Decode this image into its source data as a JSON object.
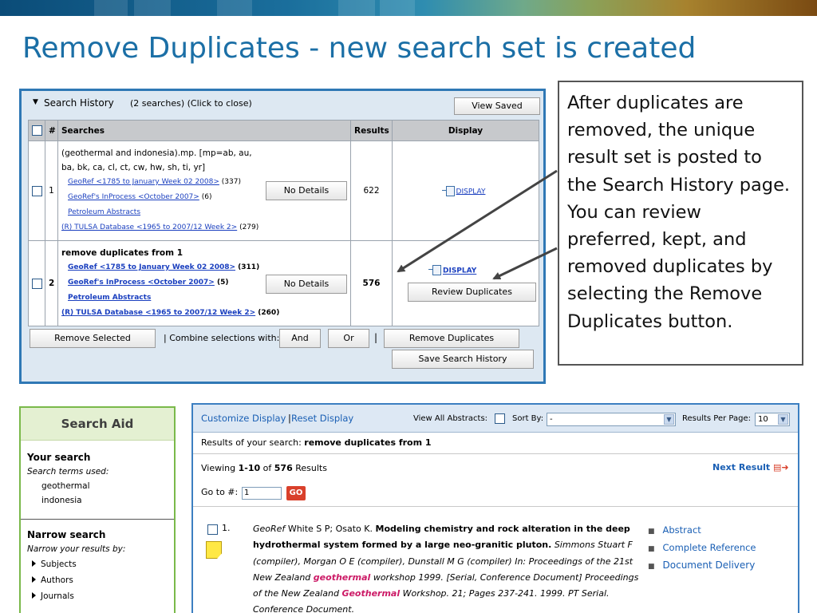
{
  "slide": {
    "title": "Remove Duplicates - new search set is created"
  },
  "callout": {
    "text": "After duplicates are removed, the unique result set is posted to the Search History page.  You can review preferred, kept, and removed duplicates by selecting the Remove Duplicates button."
  },
  "search_history": {
    "title": "Search History",
    "count": "(2 searches)  (Click to close)",
    "view_saved_label": "View Saved",
    "columns": {
      "num": "#",
      "searches": "Searches",
      "results": "Results",
      "display": "Display"
    },
    "rows": [
      {
        "num": "1",
        "query": "(geothermal and indonesia).mp. [mp=ab, au, ba, bk, ca, cl, ct, cw, hw, sh, ti, yr]",
        "dbs": [
          {
            "name": "GeoRef <1785 to January Week 02 2008>",
            "count": "(337)"
          },
          {
            "name": "GeoRef's InProcess <October 2007>",
            "count": "(6)"
          },
          {
            "name": "Petroleum Abstracts",
            "count": ""
          },
          {
            "name": "(R) TULSA Database <1965 to 2007/12 Week 2>",
            "count": "(279)"
          }
        ],
        "details_label": "No Details",
        "results": "622",
        "display_label": "DISPLAY"
      },
      {
        "num": "2",
        "query": "remove duplicates from 1",
        "dbs": [
          {
            "name": "GeoRef <1785 to January Week 02 2008>",
            "count": "(311)"
          },
          {
            "name": "GeoRef's InProcess <October 2007>",
            "count": "(5)"
          },
          {
            "name": "Petroleum Abstracts",
            "count": ""
          },
          {
            "name": "(R) TULSA Database <1965 to 2007/12 Week 2>",
            "count": "(260)"
          }
        ],
        "details_label": "No Details",
        "results": "576",
        "display_label": "DISPLAY",
        "review_label": "Review Duplicates"
      }
    ],
    "footer": {
      "remove_selected": "Remove Selected",
      "combine_label": "| Combine selections with:",
      "and_label": "And",
      "or_label": "Or",
      "separator": "|",
      "remove_duplicates": "Remove Duplicates",
      "save_history": "Save Search History"
    }
  },
  "search_aid": {
    "title": "Search Aid",
    "your_search": "Your search",
    "terms_used": "Search terms used:",
    "terms": [
      "geothermal",
      "indonesia"
    ],
    "narrow": "Narrow search",
    "narrow_by": "Narrow your results by:",
    "nav": [
      "Subjects",
      "Authors",
      "Journals"
    ]
  },
  "results_panel": {
    "customize": "Customize Display",
    "divider": "|",
    "reset": "Reset Display",
    "view_all": "View All Abstracts:",
    "sort_by": "Sort By:",
    "sort_value": "-",
    "per_page_label": "Results Per Page:",
    "per_page_value": "10",
    "results_of_prefix": "Results of your search:",
    "results_of_query": "remove duplicates from 1",
    "viewing_prefix": "Viewing",
    "viewing_range": "1-10",
    "viewing_of": "of",
    "viewing_total": "576",
    "viewing_suffix": "Results",
    "next_result": "Next Result",
    "goto_label": "Go to #:",
    "goto_value": "1",
    "go_label": "GO",
    "record": {
      "num": "1.",
      "db": "GeoRef",
      "authors": "White S P; Osato K.",
      "title": "Modeling chemistry and rock alteration in the deep hydrothermal system formed by a large neo-granitic pluton.",
      "part1": "Simmons Stuart F (compiler), Morgan O E (compiler), Dunstall M G (compiler) In: Proceedings of the 21st New Zealand",
      "hl1": "geothermal",
      "part2": "workshop 1999. [Serial, Conference Document] Proceedings of the New Zealand",
      "hl2": "Geothermal",
      "part3": "Workshop. 21; Pages 237-241. 1999. PT Serial. Conference Document."
    },
    "record_links": [
      "Abstract",
      "Complete Reference",
      "Document Delivery"
    ]
  }
}
